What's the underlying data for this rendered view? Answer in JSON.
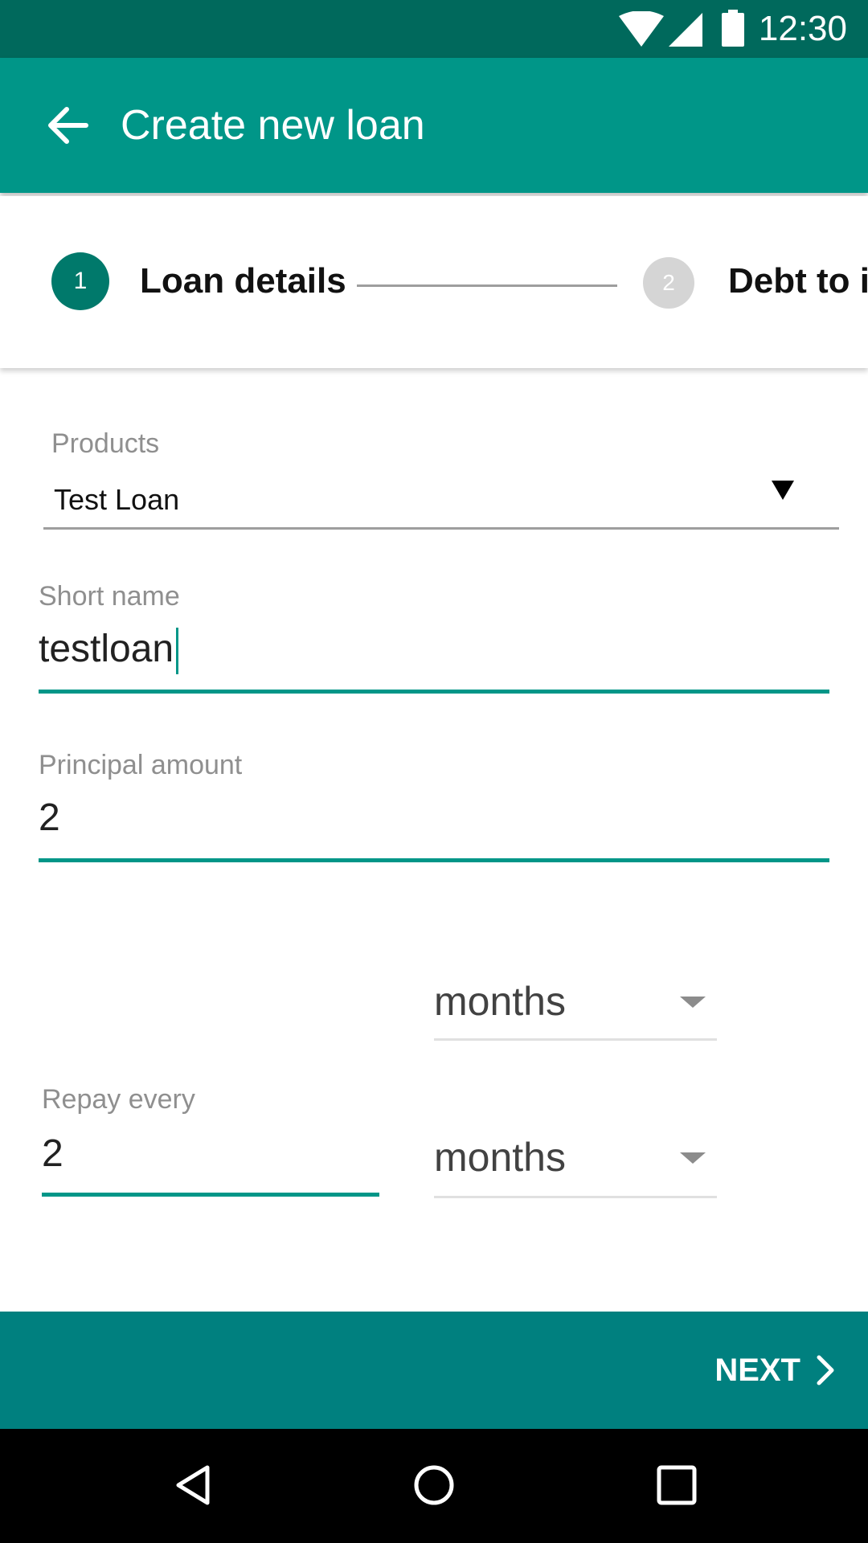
{
  "status_bar": {
    "time": "12:30"
  },
  "app_bar": {
    "title": "Create new loan"
  },
  "stepper": {
    "steps": [
      {
        "number": "1",
        "label": "Loan details"
      },
      {
        "number": "2",
        "label": "Debt to in"
      }
    ]
  },
  "form": {
    "products": {
      "label": "Products",
      "value": "Test Loan"
    },
    "short_name": {
      "label": "Short name",
      "value": "testloan"
    },
    "principal_amount": {
      "label": "Principal amount",
      "value": "2"
    },
    "term_unit": {
      "value": "months"
    },
    "repay_every": {
      "label": "Repay every",
      "value": "2"
    },
    "repay_unit": {
      "value": "months"
    }
  },
  "bottom_bar": {
    "next_label": "NEXT"
  },
  "colors": {
    "primary": "#009688",
    "primary_dark": "#00695c",
    "next_bar": "#00807f"
  }
}
